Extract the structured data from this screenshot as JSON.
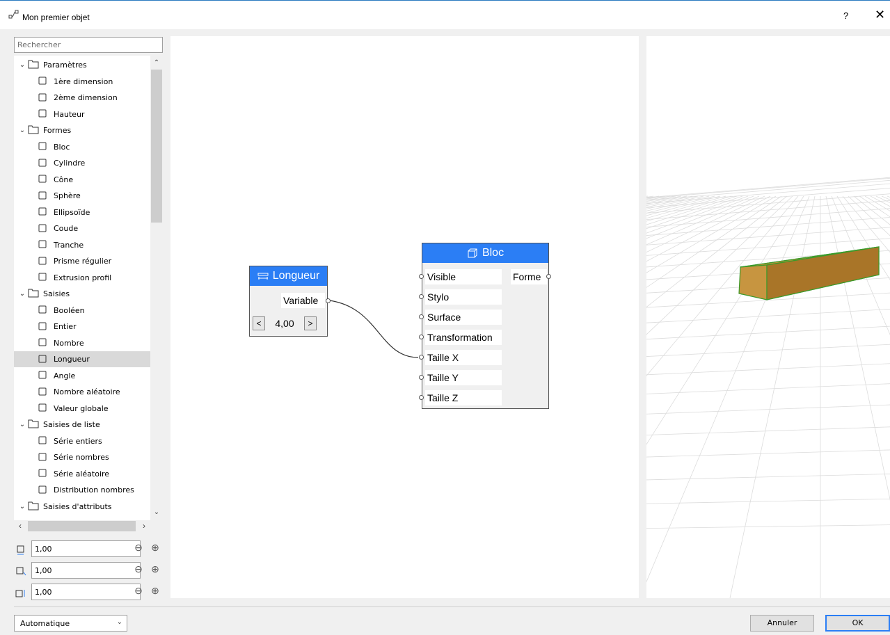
{
  "window": {
    "title": "Mon premier objet",
    "help": "?",
    "close": "✕"
  },
  "search": {
    "placeholder": "Rechercher"
  },
  "tree": {
    "groups": [
      {
        "label": "Paramètres",
        "items": [
          "1ère dimension",
          "2ème dimension",
          "Hauteur"
        ]
      },
      {
        "label": "Formes",
        "items": [
          "Bloc",
          "Cylindre",
          "Cône",
          "Sphère",
          "Ellipsoïde",
          "Coude",
          "Tranche",
          "Prisme régulier",
          "Extrusion profil"
        ]
      },
      {
        "label": "Saisies",
        "items": [
          "Booléen",
          "Entier",
          "Nombre",
          "Longueur",
          "Angle",
          "Nombre aléatoire",
          "Valeur globale"
        ]
      },
      {
        "label": "Saisies de liste",
        "items": [
          "Série entiers",
          "Série nombres",
          "Série aléatoire",
          "Distribution nombres"
        ]
      },
      {
        "label": "Saisies d'attributs",
        "items": []
      }
    ],
    "selected": "Longueur"
  },
  "dimensions": [
    {
      "value": "1,00",
      "icon": "box-dim1-icon"
    },
    {
      "value": "1,00",
      "icon": "box-dim2-icon"
    },
    {
      "value": "1,00",
      "icon": "box-height-icon"
    }
  ],
  "node_longueur": {
    "title": "Longueur",
    "output": "Variable",
    "value": "4,00",
    "dec": "<",
    "inc": ">"
  },
  "node_bloc": {
    "title": "Bloc",
    "inputs": [
      "Visible",
      "Stylo",
      "Surface",
      "Transformation",
      "Taille X",
      "Taille Y",
      "Taille Z"
    ],
    "output": "Forme"
  },
  "footer": {
    "mode": "Automatique",
    "cancel": "Annuler",
    "ok": "OK"
  },
  "colors": {
    "accent": "#2b7ef5",
    "block_fill": "#b07e2e",
    "block_edge": "#3a9a2a"
  }
}
